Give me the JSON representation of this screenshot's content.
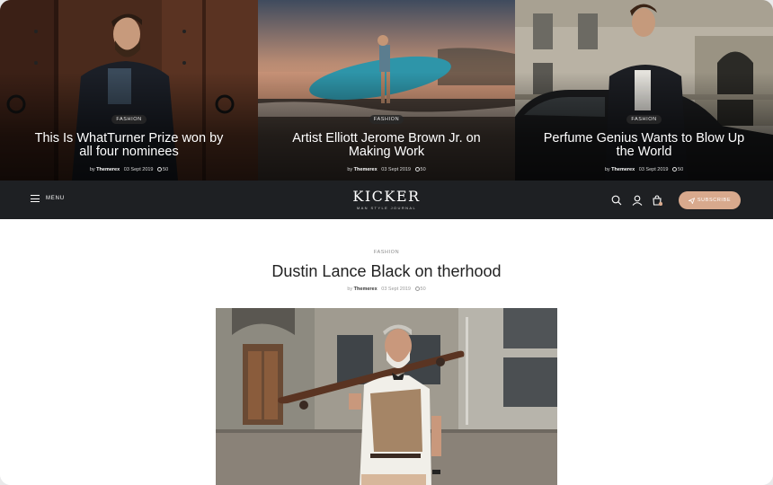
{
  "hero": [
    {
      "tag": "FASHION",
      "title": "This Is WhatTurner Prize won by all four nominees",
      "author": "Themerex",
      "date": "03 Sept 2019",
      "comments": "50"
    },
    {
      "tag": "FASHION",
      "title": "Artist Elliott Jerome Brown Jr. on Making Work",
      "author": "Themerex",
      "date": "03 Sept 2019",
      "comments": "50"
    },
    {
      "tag": "FASHION",
      "title": "Perfume Genius Wants to Blow Up the World",
      "author": "Themerex",
      "date": "03 Sept 2019",
      "comments": "50"
    }
  ],
  "nav": {
    "menu_label": "MENU",
    "logo": "KICKER",
    "logo_sub": "MAN STYLE JOURNAL",
    "subscribe_label": "SUBSCRIBE",
    "icons": [
      "search-icon",
      "user-icon",
      "cart-icon"
    ],
    "cart_badge": "0"
  },
  "article": {
    "category": "FASHION",
    "title": "Dustin Lance Black on therhood",
    "by": "by",
    "author": "Themerex",
    "date": "03 Sept 2019",
    "comments": "50"
  },
  "colors": {
    "nav_bg": "#1e2023",
    "accent": "#d8a98d"
  }
}
